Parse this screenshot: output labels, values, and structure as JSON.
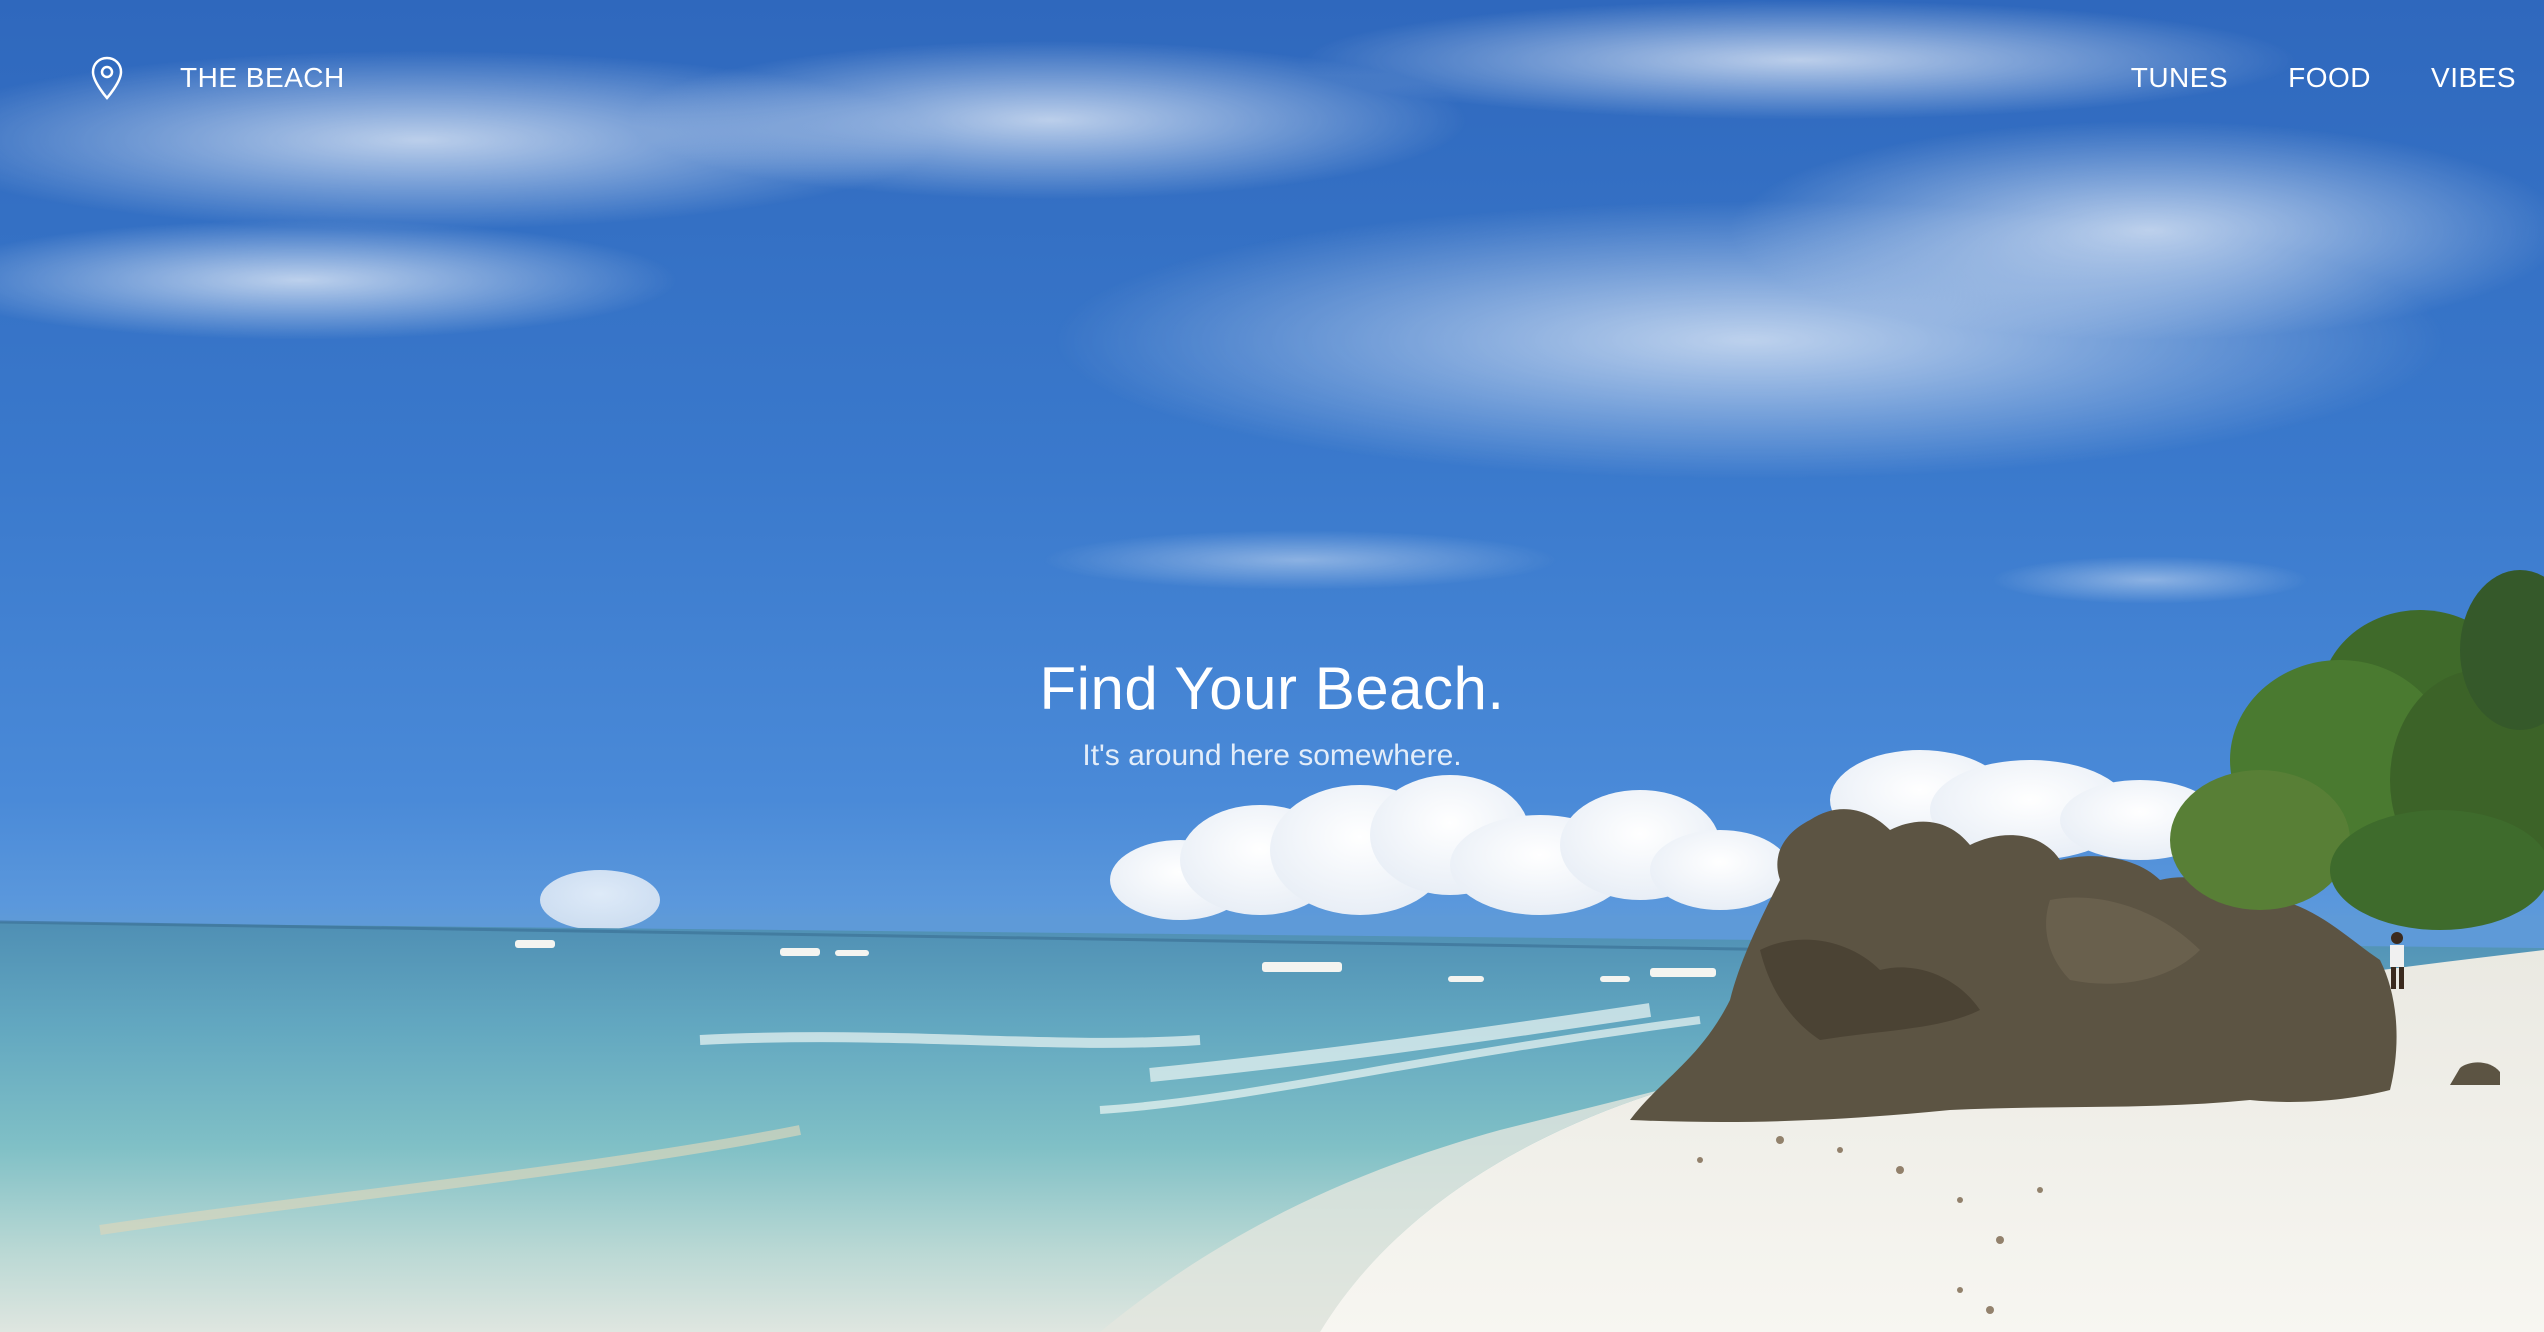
{
  "navbar": {
    "brand_icon": "map-pin-icon",
    "brand_label": "THE BEACH",
    "links": [
      {
        "label": "TUNES"
      },
      {
        "label": "FOOD"
      },
      {
        "label": "VIBES"
      }
    ]
  },
  "hero": {
    "title": "Find Your Beach.",
    "subtitle": "It's around here somewhere."
  },
  "colors": {
    "sky": "#3a79cc",
    "sea": "#5ea9c4",
    "sand": "#f4f3ee",
    "text": "#ffffff"
  }
}
